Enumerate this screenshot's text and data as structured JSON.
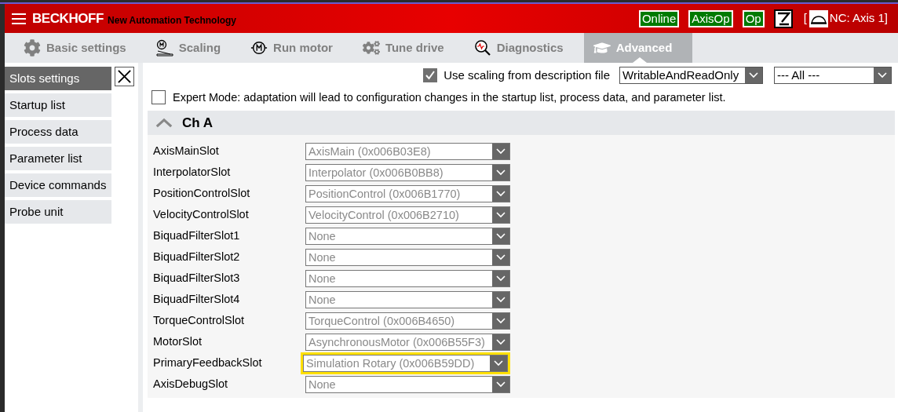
{
  "header": {
    "brand": "BECKHOFF",
    "tagline": "New Automation Technology",
    "states": [
      "Online",
      "AxisOp",
      "Op"
    ],
    "bracket_open": "[",
    "target": "NC: Axis 1]"
  },
  "tabs": [
    {
      "label": "Basic settings",
      "selected": false
    },
    {
      "label": "Scaling",
      "selected": false
    },
    {
      "label": "Run motor",
      "selected": false
    },
    {
      "label": "Tune drive",
      "selected": false
    },
    {
      "label": "Diagnostics",
      "selected": false
    },
    {
      "label": "Advanced",
      "selected": true
    }
  ],
  "sidebar": {
    "items": [
      {
        "label": "Slots settings",
        "selected": true
      },
      {
        "label": "Startup list",
        "selected": false
      },
      {
        "label": "Process data",
        "selected": false
      },
      {
        "label": "Parameter list",
        "selected": false
      },
      {
        "label": "Device commands",
        "selected": false
      },
      {
        "label": "Probe unit",
        "selected": false
      }
    ]
  },
  "toolbar": {
    "scaling": {
      "label": "Use scaling from description file",
      "checked": true
    },
    "access_filter": "WritableAndReadOnly",
    "group_filter": "--- All ---"
  },
  "expert_mode": {
    "label": "Expert Mode: adaptation will lead to configuration changes in the startup list, process data, and parameter list.",
    "checked": false
  },
  "section": {
    "title": "Ch A",
    "expanded": true,
    "slots": [
      {
        "label": "AxisMainSlot",
        "value": "AxisMain (0x006B03E8)",
        "highlighted": false
      },
      {
        "label": "InterpolatorSlot",
        "value": "Interpolator (0x006B0BB8)",
        "highlighted": false
      },
      {
        "label": "PositionControlSlot",
        "value": "PositionControl (0x006B1770)",
        "highlighted": false
      },
      {
        "label": "VelocityControlSlot",
        "value": "VelocityControl (0x006B2710)",
        "highlighted": false
      },
      {
        "label": "BiquadFilterSlot1",
        "value": "None",
        "highlighted": false
      },
      {
        "label": "BiquadFilterSlot2",
        "value": "None",
        "highlighted": false
      },
      {
        "label": "BiquadFilterSlot3",
        "value": "None",
        "highlighted": false
      },
      {
        "label": "BiquadFilterSlot4",
        "value": "None",
        "highlighted": false
      },
      {
        "label": "TorqueControlSlot",
        "value": "TorqueControl (0x006B4650)",
        "highlighted": false
      },
      {
        "label": "MotorSlot",
        "value": "AsynchronousMotor (0x006B55F3)",
        "highlighted": false
      },
      {
        "label": "PrimaryFeedbackSlot",
        "value": "Simulation Rotary (0x006B59DD)",
        "highlighted": true
      },
      {
        "label": "AxisDebugSlot",
        "value": "None",
        "highlighted": false
      }
    ]
  }
}
